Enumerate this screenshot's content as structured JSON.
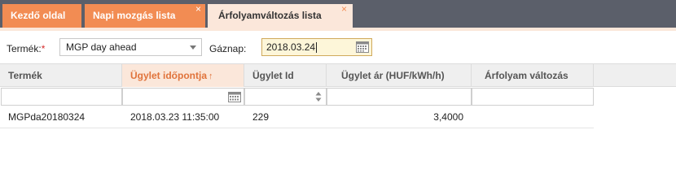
{
  "tabs": [
    {
      "label": "Kezdő oldal",
      "state": "inactive",
      "closable": false
    },
    {
      "label": "Napi mozgás lista",
      "state": "inactive",
      "closable": true
    },
    {
      "label": "Árfolyamváltozás lista",
      "state": "active",
      "closable": true
    }
  ],
  "close_glyph": "×",
  "filters": {
    "product_label": "Termék:",
    "required_mark": "*",
    "product_value": "MGP day ahead",
    "gasday_label": "Gáznap:",
    "gasday_value": "2018.03.24"
  },
  "table": {
    "columns": [
      "Termék",
      "Ügylet időpontja",
      "Ügylet Id",
      "Ügylet ár (HUF/kWh/h)",
      "Árfolyam változás"
    ],
    "sorted_column": "Ügylet időpontja",
    "sort_glyph": "🠕",
    "rows": [
      [
        "MGPda20180324",
        "2018.03.23 11:35:00",
        "229",
        "3,4000",
        ""
      ]
    ]
  },
  "colors": {
    "tab_inactive": "#f28c53",
    "tab_active": "#fbe7da",
    "tabbar_bg": "#5b5f6a",
    "sorted_header_text": "#e0733b",
    "date_field_bg": "#fdf6d9"
  },
  "icons": {
    "date_picker": "calendar-icon",
    "select": "chevron-down-icon",
    "number_filter": "spinner-icon"
  }
}
